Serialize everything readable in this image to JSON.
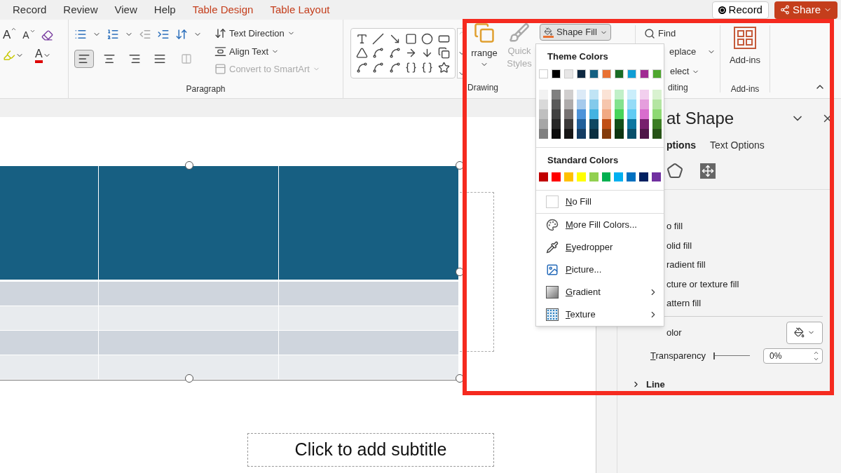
{
  "tabs": [
    {
      "label": "Record",
      "kind": "standard"
    },
    {
      "label": "Review",
      "kind": "standard"
    },
    {
      "label": "View",
      "kind": "standard"
    },
    {
      "label": "Help",
      "kind": "standard"
    },
    {
      "label": "Table Design",
      "kind": "contextual"
    },
    {
      "label": "Table Layout",
      "kind": "contextual"
    }
  ],
  "header_buttons": {
    "record": "Record",
    "share": "Share"
  },
  "ribbon": {
    "font_buttons": [
      {
        "kind": "grow",
        "glyph": "A"
      },
      {
        "kind": "shrink",
        "glyph": "A"
      },
      {
        "kind": "font-color",
        "glyph": "A"
      }
    ],
    "paragraph": {
      "label": "Paragraph",
      "text_direction": "Text Direction",
      "align_text": "Align Text",
      "convert_smartart": {
        "label": "Convert to SmartArt",
        "disabled": true
      },
      "alignment": [
        {
          "kind": "left",
          "selected": true
        },
        {
          "kind": "center",
          "selected": false
        },
        {
          "kind": "right",
          "selected": false
        },
        {
          "kind": "justify",
          "selected": false
        }
      ]
    },
    "drawing": {
      "label": "Drawing",
      "arrange": "rrange",
      "quick_styles": {
        "label": "Quick Styles",
        "disabled": true
      },
      "shape_fill": {
        "label": "Shape Fill",
        "pressed": true
      }
    },
    "editing": {
      "label": "diting",
      "find": "Find",
      "replace": "eplace",
      "select": "elect"
    },
    "addins": {
      "button": "Add-ins",
      "label": "Add-ins"
    }
  },
  "fill_menu": {
    "theme_title": "Theme Colors",
    "theme_colors": [
      {
        "color": "#ffffff",
        "shades": [
          {
            "color": "#f2f2f2"
          },
          {
            "color": "#d9d9d9"
          },
          {
            "color": "#bfbfbf"
          },
          {
            "color": "#a6a6a6"
          },
          {
            "color": "#808080"
          }
        ]
      },
      {
        "color": "#000000",
        "shades": [
          {
            "color": "#7f7f7f"
          },
          {
            "color": "#595959"
          },
          {
            "color": "#404040"
          },
          {
            "color": "#262626"
          },
          {
            "color": "#0d0d0d"
          }
        ]
      },
      {
        "color": "#e7e6e6",
        "shades": [
          {
            "color": "#d0cece"
          },
          {
            "color": "#aeabab"
          },
          {
            "color": "#767171"
          },
          {
            "color": "#3a3838"
          },
          {
            "color": "#171616"
          }
        ]
      },
      {
        "color": "#0e2841",
        "shades": [
          {
            "color": "#dceaf7"
          },
          {
            "color": "#a6caec"
          },
          {
            "color": "#4d93d9"
          },
          {
            "color": "#215f9a"
          },
          {
            "color": "#153d63"
          }
        ]
      },
      {
        "color": "#156082",
        "shades": [
          {
            "color": "#c0e4f5"
          },
          {
            "color": "#83caeb"
          },
          {
            "color": "#44b3e1"
          },
          {
            "color": "#0f4761"
          },
          {
            "color": "#0a2f41"
          }
        ]
      },
      {
        "color": "#e97132",
        "shades": [
          {
            "color": "#fbe3d6"
          },
          {
            "color": "#f6c6ad"
          },
          {
            "color": "#f1a983"
          },
          {
            "color": "#c04f15"
          },
          {
            "color": "#843c0c"
          }
        ]
      },
      {
        "color": "#196b24",
        "shades": [
          {
            "color": "#c1f0c8"
          },
          {
            "color": "#83e28e"
          },
          {
            "color": "#47d45a"
          },
          {
            "color": "#124f1a"
          },
          {
            "color": "#0d3512"
          }
        ]
      },
      {
        "color": "#0f9ed5",
        "shades": [
          {
            "color": "#caeefb"
          },
          {
            "color": "#95dcf7"
          },
          {
            "color": "#61cbf3"
          },
          {
            "color": "#0b76a0"
          },
          {
            "color": "#074f6a"
          }
        ]
      },
      {
        "color": "#a02b93",
        "shades": [
          {
            "color": "#f2cfee"
          },
          {
            "color": "#e59edd"
          },
          {
            "color": "#d86dcd"
          },
          {
            "color": "#77206d"
          },
          {
            "color": "#4f1548"
          }
        ]
      },
      {
        "color": "#4ea72e",
        "shades": [
          {
            "color": "#d9f2d0"
          },
          {
            "color": "#b4e5a2"
          },
          {
            "color": "#8ed973"
          },
          {
            "color": "#3b7d23"
          },
          {
            "color": "#275317"
          }
        ]
      }
    ],
    "standard_title": "Standard Colors",
    "standard_colors": [
      {
        "color": "#c00000"
      },
      {
        "color": "#ff0000"
      },
      {
        "color": "#ffc000"
      },
      {
        "color": "#ffff00"
      },
      {
        "color": "#92d050"
      },
      {
        "color": "#00b050"
      },
      {
        "color": "#00b0f0"
      },
      {
        "color": "#0070c0"
      },
      {
        "color": "#002060"
      },
      {
        "color": "#7030a0"
      }
    ],
    "items": [
      {
        "label": "No Fill",
        "kind": "no-fill",
        "submenu": false
      },
      {
        "label": "More Fill Colors...",
        "kind": "palette",
        "submenu": false
      },
      {
        "label": "Eyedropper",
        "kind": "eyedropper",
        "submenu": false
      },
      {
        "label": "Picture...",
        "kind": "picture",
        "submenu": false
      },
      {
        "label": "Gradient",
        "kind": "gradient",
        "submenu": true
      },
      {
        "label": "Texture",
        "kind": "texture",
        "submenu": true
      }
    ]
  },
  "slide": {
    "subtitle_placeholder": "Click to add subtitle",
    "table_rows": [
      {
        "kind": "header"
      },
      {
        "kind": "band"
      },
      {
        "kind": "plain"
      },
      {
        "kind": "band"
      },
      {
        "kind": "plain"
      }
    ]
  },
  "format_pane": {
    "title": "at Shape",
    "tabs": [
      {
        "label": "ptions",
        "selected": true
      },
      {
        "label": "Text Options",
        "selected": false
      }
    ],
    "fill_options": [
      {
        "label": "o fill"
      },
      {
        "label": "olid fill"
      },
      {
        "label": "radient fill"
      },
      {
        "label": "cture or texture fill"
      },
      {
        "label": "attern fill"
      }
    ],
    "color_label": "olor",
    "transparency": {
      "label": "Transparency",
      "value": "0%",
      "level": 0
    },
    "line_section": {
      "label": "Line",
      "expanded": false
    }
  }
}
